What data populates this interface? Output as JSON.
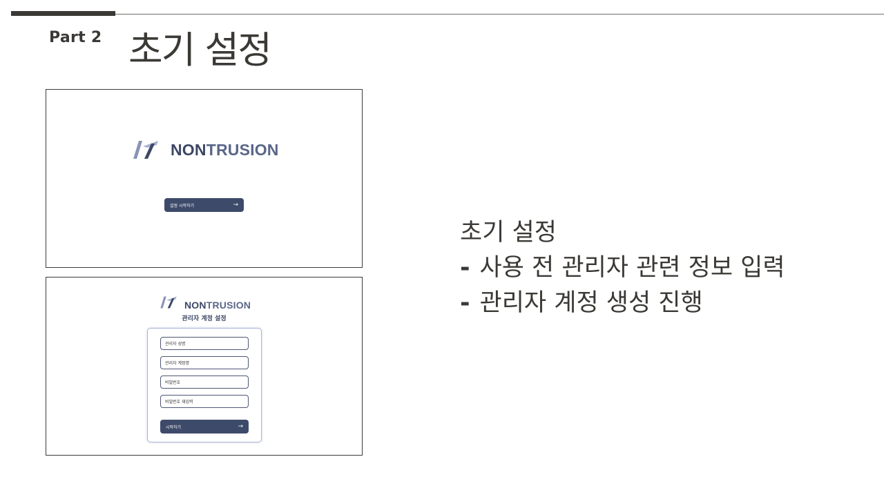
{
  "header": {
    "part": "Part 2",
    "title": "초기 설정"
  },
  "screenshot1": {
    "logo_text_a": "NON",
    "logo_text_b": "TRUSION",
    "start_button": "설정 시작하기",
    "arrow": "→"
  },
  "screenshot2": {
    "logo_text_a": "NON",
    "logo_text_b": "TRUSION",
    "subtitle": "관리자 계정 설정",
    "fields": [
      {
        "placeholder": "관리자 성명"
      },
      {
        "placeholder": "관리자 계정명"
      },
      {
        "placeholder": "비밀번호"
      },
      {
        "placeholder": "비밀번호 재입력"
      }
    ],
    "submit_button": "시작하기",
    "arrow": "→"
  },
  "description": {
    "heading": "초기 설정",
    "bullets": [
      {
        "dash": "-",
        "text": "사용 전 관리자 관련 정보 입력"
      },
      {
        "dash": "-",
        "text": "관리자 계정 생성 진행"
      }
    ]
  },
  "colors": {
    "dark": "#3b3935",
    "brand": "#3e4a6a"
  }
}
